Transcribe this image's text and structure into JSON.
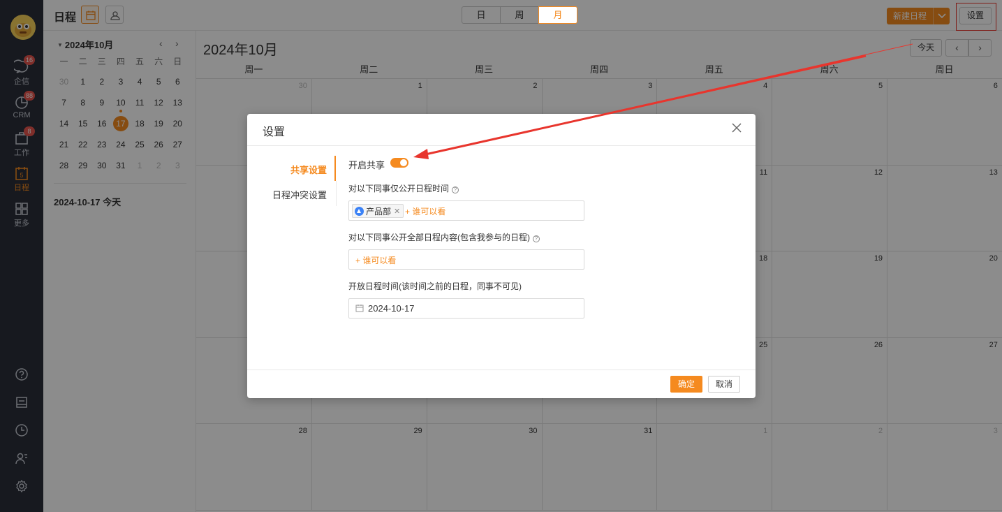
{
  "nav": {
    "items": [
      {
        "label": "企信",
        "badge": "16"
      },
      {
        "label": "CRM",
        "badge": "88"
      },
      {
        "label": "工作",
        "badge": "8"
      },
      {
        "label": "日程",
        "icon_text": "5"
      },
      {
        "label": "更多"
      }
    ]
  },
  "header": {
    "title": "日程",
    "views": [
      "日",
      "周",
      "月"
    ],
    "active_view": "月",
    "new_schedule": "新建日程",
    "settings": "设置"
  },
  "mini_calendar": {
    "title": "2024年10月",
    "weekdays": [
      "一",
      "二",
      "三",
      "四",
      "五",
      "六",
      "日"
    ],
    "weeks": [
      [
        "30",
        "1",
        "2",
        "3",
        "4",
        "5",
        "6"
      ],
      [
        "7",
        "8",
        "9",
        "10",
        "11",
        "12",
        "13"
      ],
      [
        "14",
        "15",
        "16",
        "17",
        "18",
        "19",
        "20"
      ],
      [
        "21",
        "22",
        "23",
        "24",
        "25",
        "26",
        "27"
      ],
      [
        "28",
        "29",
        "30",
        "31",
        "1",
        "2",
        "3"
      ]
    ],
    "today_label": "2024-10-17 今天"
  },
  "calendar": {
    "title": "2024年10月",
    "today_btn": "今天",
    "weekdays": [
      "周一",
      "周二",
      "周三",
      "周四",
      "周五",
      "周六",
      "周日"
    ],
    "weeks": [
      [
        "30",
        "1",
        "2",
        "3",
        "4",
        "5",
        "6"
      ],
      [
        "",
        "",
        "",
        "",
        "11",
        "12",
        "13"
      ],
      [
        "",
        "",
        "",
        "",
        "18",
        "19",
        "20"
      ],
      [
        "",
        "",
        "",
        "",
        "25",
        "26",
        "27"
      ],
      [
        "28",
        "29",
        "30",
        "31",
        "1",
        "2",
        "3"
      ]
    ]
  },
  "modal": {
    "title": "设置",
    "tabs": [
      "共享设置",
      "日程冲突设置"
    ],
    "enable_share_label": "开启共享",
    "share_enabled": true,
    "time_only_label": "对以下同事仅公开日程时间",
    "time_only_tag": "产品部",
    "add_viewer": "+ 谁可以看",
    "full_content_label": "对以下同事公开全部日程内容(包含我参与的日程)",
    "open_time_label": "开放日程时间(该时间之前的日程，同事不可见)",
    "open_date": "2024-10-17",
    "confirm": "确定",
    "cancel": "取消"
  },
  "colors": {
    "accent": "#f58a1f",
    "nav_bg": "#2b2f3a",
    "annotation": "#e8352d"
  }
}
